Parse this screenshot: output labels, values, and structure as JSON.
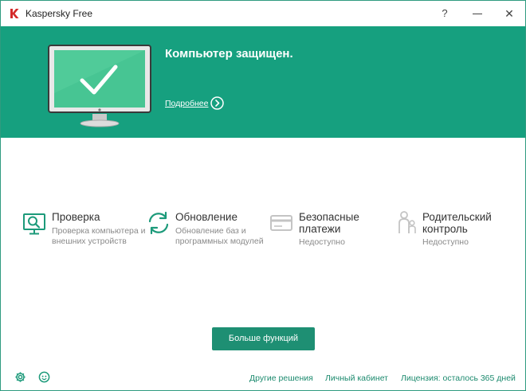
{
  "titlebar": {
    "title": "Kaspersky Free",
    "help": "?",
    "close": "✕"
  },
  "banner": {
    "status": "Компьютер защищен.",
    "details_link": "Подробнее",
    "color": "#16a07f"
  },
  "features": [
    {
      "title": "Проверка",
      "desc": "Проверка компьютера и внешних устройств",
      "icon": "scan-monitor-icon"
    },
    {
      "title": "Обновление",
      "desc": "Обновление баз и программных модулей",
      "icon": "update-arrows-icon"
    },
    {
      "title": "Безопасные платежи",
      "desc": "Недоступно",
      "icon": "safe-money-card-icon"
    },
    {
      "title": "Родительский контроль",
      "desc": "Недоступно",
      "icon": "parental-control-icon"
    }
  ],
  "more_button": "Больше функций",
  "footer": {
    "links": [
      "Другие решения",
      "Личный кабинет",
      "Лицензия: осталось 365 дней"
    ],
    "icons": [
      "gear-icon",
      "support-icon"
    ]
  },
  "colors": {
    "accent": "#16a07f",
    "button": "#1e8f73",
    "link": "#1c8a6e"
  }
}
